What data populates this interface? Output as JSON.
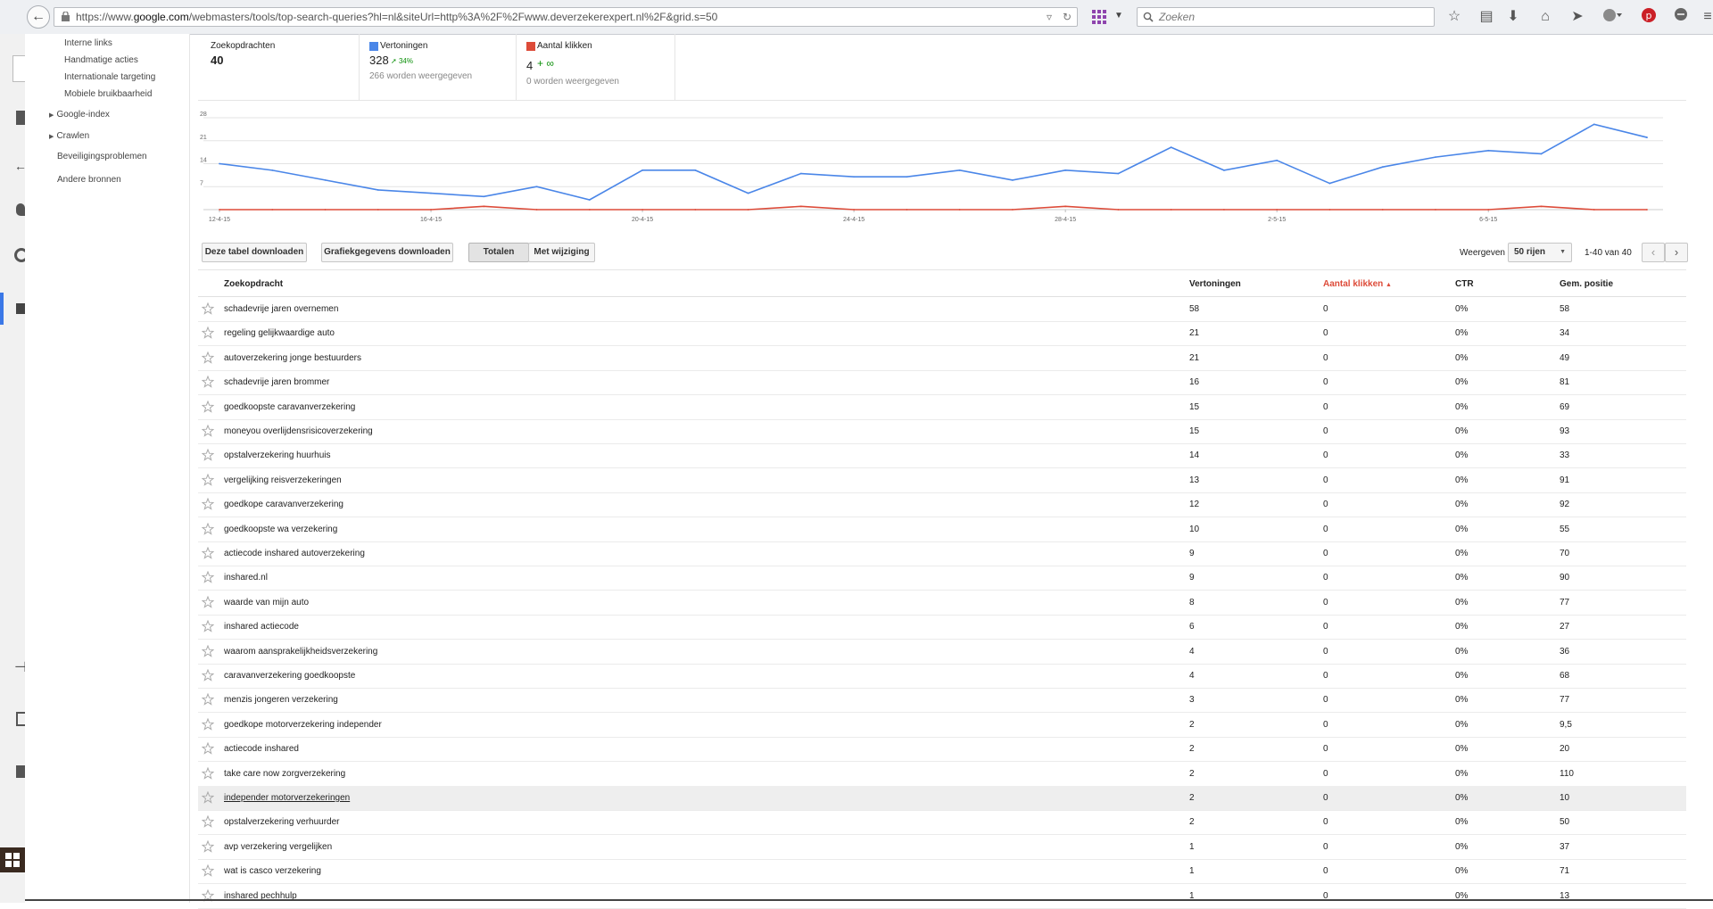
{
  "browser": {
    "url_prefix": "https://www.",
    "url_domain": "google.com",
    "url_path": "/webmasters/tools/top-search-queries?hl=nl&siteUrl=http%3A%2F%2Fwww.deverzekerexpert.nl%2F&grid.s=50",
    "search_placeholder": "Zoeken"
  },
  "sidebar": {
    "subitems": [
      "Interne links",
      "Handmatige acties",
      "Internationale targeting",
      "Mobiele bruikbaarheid"
    ],
    "sections": [
      "Google-index",
      "Crawlen",
      "Beveiligingsproblemen",
      "Andere bronnen"
    ]
  },
  "summary": {
    "queries": {
      "title": "Zoekopdrachten",
      "value": "40"
    },
    "impressions": {
      "title": "Vertoningen",
      "value": "328",
      "change": "34%",
      "sub": "266 worden weergegeven",
      "color": "#4a86e8"
    },
    "clicks": {
      "title": "Aantal klikken",
      "value": "4",
      "change": "∞",
      "sub": "0 worden weergegeven",
      "color": "#dd4b39"
    }
  },
  "chart_data": {
    "type": "line",
    "y_ticks": [
      "28",
      "21",
      "14",
      "7"
    ],
    "ylim": [
      0,
      28
    ],
    "x_tick_labels": [
      "12-4-15",
      "16-4-15",
      "20-4-15",
      "24-4-15",
      "28-4-15",
      "2-5-15",
      "6-5-15"
    ],
    "x": [
      "12-4-15",
      "13-4-15",
      "14-4-15",
      "15-4-15",
      "16-4-15",
      "17-4-15",
      "18-4-15",
      "19-4-15",
      "20-4-15",
      "21-4-15",
      "22-4-15",
      "23-4-15",
      "24-4-15",
      "25-4-15",
      "26-4-15",
      "27-4-15",
      "28-4-15",
      "29-4-15",
      "30-4-15",
      "1-5-15",
      "2-5-15",
      "3-5-15",
      "4-5-15",
      "5-5-15",
      "6-5-15",
      "7-5-15",
      "8-5-15",
      "9-5-15"
    ],
    "series": [
      {
        "color": "#4a86e8",
        "values": [
          14,
          12,
          9,
          6,
          5,
          4,
          7,
          3,
          12,
          12,
          5,
          11,
          10,
          10,
          12,
          9,
          12,
          11,
          19,
          12,
          15,
          8,
          13,
          16,
          18,
          17,
          26,
          22
        ]
      },
      {
        "color": "#dd4b39",
        "values": [
          0,
          0,
          0,
          0,
          0,
          1,
          0,
          0,
          0,
          0,
          0,
          1,
          0,
          0,
          0,
          0,
          1,
          0,
          0,
          0,
          0,
          0,
          0,
          0,
          0,
          1,
          0,
          0
        ]
      }
    ],
    "grid": true
  },
  "toolbar": {
    "download_table": "Deze tabel downloaden",
    "download_chart": "Grafiekgegevens downloaden",
    "totals": "Totalen",
    "with_change": "Met wijziging",
    "show_label": "Weergeven",
    "rows_select": "50 rijen",
    "range": "1-40 van 40"
  },
  "table": {
    "headers": {
      "query": "Zoekopdracht",
      "impressions": "Vertoningen",
      "clicks": "Aantal klikken",
      "ctr": "CTR",
      "position": "Gem. positie"
    },
    "sorted_color": "#dd4b39",
    "rows": [
      {
        "query": "schadevrije jaren overnemen",
        "impressions": "58",
        "clicks": "0",
        "ctr": "0%",
        "position": "58"
      },
      {
        "query": "regeling gelijkwaardige auto",
        "impressions": "21",
        "clicks": "0",
        "ctr": "0%",
        "position": "34"
      },
      {
        "query": "autoverzekering jonge bestuurders",
        "impressions": "21",
        "clicks": "0",
        "ctr": "0%",
        "position": "49"
      },
      {
        "query": "schadevrije jaren brommer",
        "impressions": "16",
        "clicks": "0",
        "ctr": "0%",
        "position": "81"
      },
      {
        "query": "goedkoopste caravanverzekering",
        "impressions": "15",
        "clicks": "0",
        "ctr": "0%",
        "position": "69"
      },
      {
        "query": "moneyou overlijdensrisicoverzekering",
        "impressions": "15",
        "clicks": "0",
        "ctr": "0%",
        "position": "93"
      },
      {
        "query": "opstalverzekering huurhuis",
        "impressions": "14",
        "clicks": "0",
        "ctr": "0%",
        "position": "33"
      },
      {
        "query": "vergelijking reisverzekeringen",
        "impressions": "13",
        "clicks": "0",
        "ctr": "0%",
        "position": "91"
      },
      {
        "query": "goedkope caravanverzekering",
        "impressions": "12",
        "clicks": "0",
        "ctr": "0%",
        "position": "92"
      },
      {
        "query": "goedkoopste wa verzekering",
        "impressions": "10",
        "clicks": "0",
        "ctr": "0%",
        "position": "55"
      },
      {
        "query": "actiecode inshared autoverzekering",
        "impressions": "9",
        "clicks": "0",
        "ctr": "0%",
        "position": "70"
      },
      {
        "query": "inshared.nl",
        "impressions": "9",
        "clicks": "0",
        "ctr": "0%",
        "position": "90"
      },
      {
        "query": "waarde van mijn auto",
        "impressions": "8",
        "clicks": "0",
        "ctr": "0%",
        "position": "77"
      },
      {
        "query": "inshared actiecode",
        "impressions": "6",
        "clicks": "0",
        "ctr": "0%",
        "position": "27"
      },
      {
        "query": "waarom aansprakelijkheidsverzekering",
        "impressions": "4",
        "clicks": "0",
        "ctr": "0%",
        "position": "36"
      },
      {
        "query": "caravanverzekering goedkoopste",
        "impressions": "4",
        "clicks": "0",
        "ctr": "0%",
        "position": "68"
      },
      {
        "query": "menzis jongeren verzekering",
        "impressions": "3",
        "clicks": "0",
        "ctr": "0%",
        "position": "77"
      },
      {
        "query": "goedkope motorverzekering independer",
        "impressions": "2",
        "clicks": "0",
        "ctr": "0%",
        "position": "9,5"
      },
      {
        "query": "actiecode inshared",
        "impressions": "2",
        "clicks": "0",
        "ctr": "0%",
        "position": "20"
      },
      {
        "query": "take care now zorgverzekering",
        "impressions": "2",
        "clicks": "0",
        "ctr": "0%",
        "position": "110"
      },
      {
        "query": "independer motorverzekeringen",
        "impressions": "2",
        "clicks": "0",
        "ctr": "0%",
        "position": "10"
      },
      {
        "query": "opstalverzekering verhuurder",
        "impressions": "2",
        "clicks": "0",
        "ctr": "0%",
        "position": "50"
      },
      {
        "query": "avp verzekering vergelijken",
        "impressions": "1",
        "clicks": "0",
        "ctr": "0%",
        "position": "37"
      },
      {
        "query": "wat is casco verzekering",
        "impressions": "1",
        "clicks": "0",
        "ctr": "0%",
        "position": "71"
      },
      {
        "query": "inshared pechhulp",
        "impressions": "1",
        "clicks": "0",
        "ctr": "0%",
        "position": "13"
      }
    ]
  }
}
